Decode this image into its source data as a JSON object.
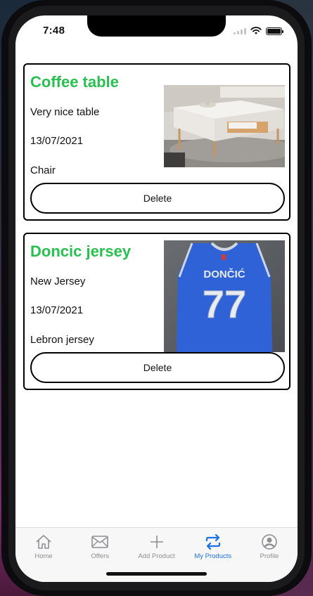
{
  "status_bar": {
    "time": "7:48"
  },
  "products": [
    {
      "title": "Coffee table",
      "description": "Very nice table",
      "date": "13/07/2021",
      "exchange_for": "Chair",
      "image_icon": "coffee-table-photo",
      "delete_label": "Delete"
    },
    {
      "title": "Doncic jersey",
      "description": "New Jersey",
      "date": "13/07/2021",
      "exchange_for": "Lebron jersey",
      "image_icon": "jersey-photo",
      "jersey_name": "DONČIĆ",
      "jersey_number": "77",
      "delete_label": "Delete"
    }
  ],
  "tabs": [
    {
      "label": "Home",
      "icon": "home-icon",
      "active": false
    },
    {
      "label": "Offers",
      "icon": "envelope-icon",
      "active": false
    },
    {
      "label": "Add Product",
      "icon": "plus-icon",
      "active": false
    },
    {
      "label": "My Products",
      "icon": "swap-icon",
      "active": true
    },
    {
      "label": "Profile",
      "icon": "profile-icon",
      "active": false
    }
  ],
  "colors": {
    "title_green": "#28c050",
    "active_tab": "#1a73e8",
    "inactive_tab": "#8e8e93",
    "jersey_blue": "#2a5ccc"
  }
}
